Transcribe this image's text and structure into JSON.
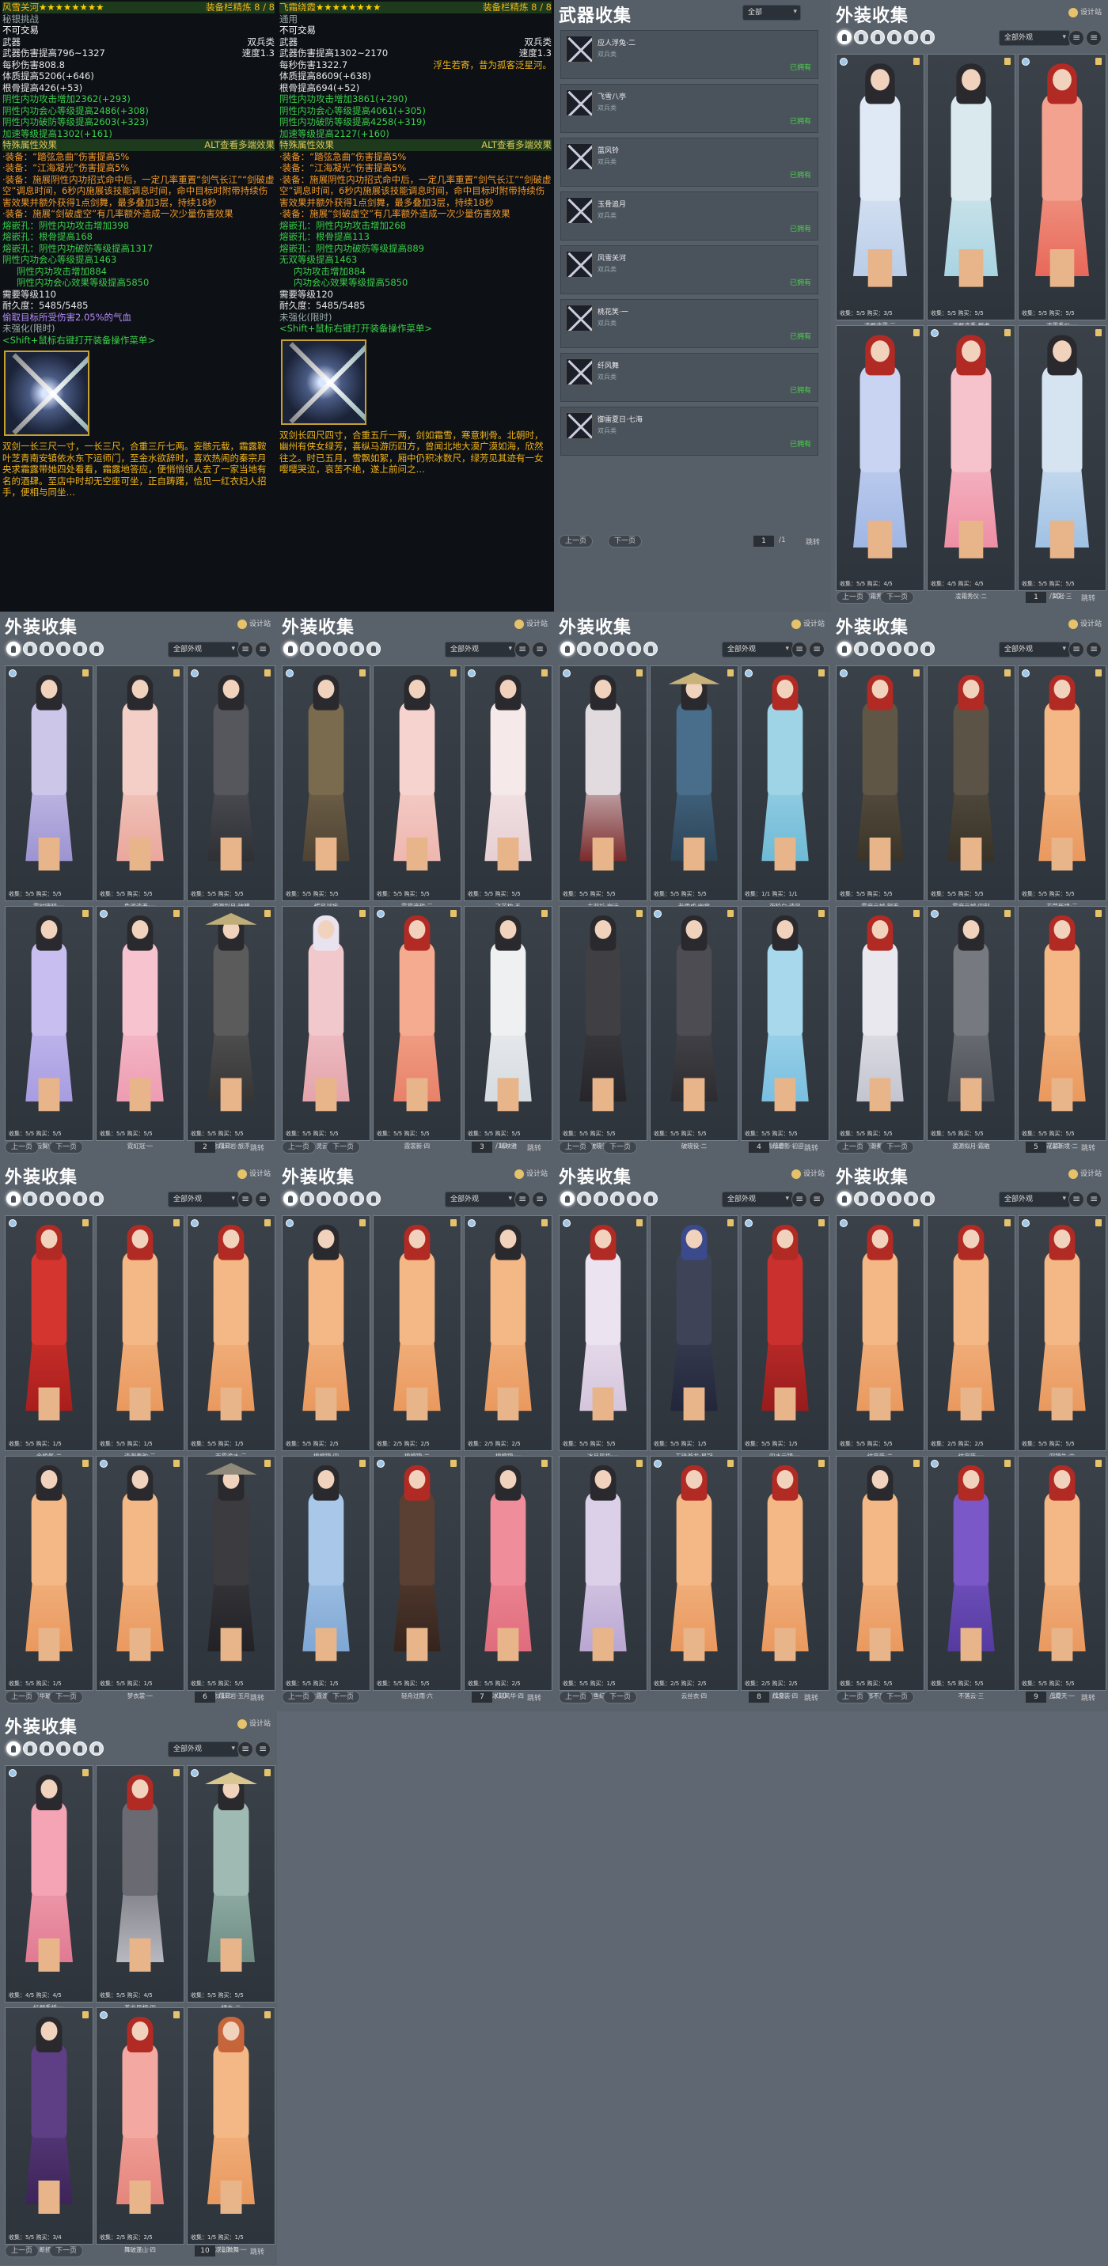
{
  "tooltips": [
    {
      "title": "风雪关河",
      "stars": "★★★★★★★★",
      "title_suffix": "…",
      "slot_right": "装备栏精炼 8 / 8",
      "sub1": "秘银挑战",
      "sub2": "不可交易",
      "type": "武器",
      "kind": "双兵类",
      "dmg": "武器伤害提高796~1327",
      "speed": "速度1.3",
      "dps": "每秒伤害808.8",
      "motto": "",
      "stats": [
        "体质提高5206(+646)",
        "根骨提高426(+53)",
        "阴性内功攻击增加2362(+293)",
        "阴性内功会心等级提高2486(+308)",
        "阴性内功破防等级提高2603(+323)",
        "加速等级提高1302(+161)"
      ],
      "special_hdr": "特殊属性效果",
      "special_right": "ALT查看多端效果",
      "specials": [
        "·装备：“踏弦急曲”伤害提高5%",
        "·装备：“江海凝光”伤害提高5%",
        "·装备：施展阴性内功招式命中后，一定几率重置“剑气长江”“剑破虚空”调息时间，6秒内施展该技能调息时间，命中目标时附带持续伤害效果并额外获得1点剑舞，最多叠加3层，持续18秒",
        "·装备：施展“剑破虚空”有几率额外造成一次少量伤害效果"
      ],
      "gems": [
        "熔嵌孔：阴性内功攻击增加398",
        "熔嵌孔：根骨提高168",
        "熔嵌孔：阴性内功破防等级提高1317"
      ],
      "set": [
        "阴性内功会心等级提高1463",
        "阴性内功攻击增加884",
        "阴性内功会心效果等级提高5850"
      ],
      "req": "需要等级110",
      "dur": "耐久度：5485/5485",
      "extra": "偷取目标所受伤害2.05%的气血",
      "unref": "未强化(限时)",
      "shift": "<Shift+鼠标右键打开装备操作菜单>",
      "lore": "双剑一长三尺一寸，一长三尺，合重三斤七两。妄骸元载，霜露鞍叶芝青南安镇依水东下运师门，至金水欲辞时，喜欢热闹的秦宗月央求霜露带她四处看看，霜露地答应，便悄悄领人去了一家当地有名的酒肆。至店中时却无空座可坐，正自踌躇，恰见一红衣妇人招手，便相与同坐…"
    },
    {
      "title": "飞霜绕霞",
      "stars": "★★★★★★★★",
      "title_suffix": "…",
      "slot_right": "装备栏精炼 8 / 8",
      "sub1": "通用",
      "sub2": "不可交易",
      "type": "武器",
      "kind": "双兵类",
      "dmg": "武器伤害提高1302~2170",
      "speed": "速度1.3",
      "dps": "每秒伤害1322.7",
      "motto": "浮生若寄，昔为孤客泛星河。",
      "stats": [
        "体质提高8609(+638)",
        "根骨提高694(+52)",
        "阴性内功攻击增加3861(+290)",
        "阴性内功会心等级提高4061(+305)",
        "阴性内功破防等级提高4258(+319)",
        "加速等级提高2127(+160)"
      ],
      "special_hdr": "特殊属性效果",
      "special_right": "ALT查看多端效果",
      "specials": [
        "·装备：“踏弦急曲”伤害提高5%",
        "·装备：“江海凝光”伤害提高5%",
        "·装备：施展阴性内功招式命中后，一定几率重置“剑气长江”“剑破虚空”调息时间，6秒内施展该技能调息时间，命中目标时附带持续伤害效果并额外获得1点剑舞，最多叠加3层，持续18秒",
        "·装备：施展“剑破虚空”有几率额外造成一次少量伤害效果"
      ],
      "gems": [
        "熔嵌孔：阴性内功攻击增加268",
        "熔嵌孔：根骨提高113",
        "熔嵌孔：阴性内功破防等级提高889"
      ],
      "set": [
        "无双等级提高1463",
        "内功攻击增加884",
        "内功会心效果等级提高5850"
      ],
      "req": "需要等级120",
      "dur": "耐久度：5485/5485",
      "extra": "",
      "unref": "未强化(限时)",
      "shift": "<Shift+鼠标右键打开装备操作菜单>",
      "lore": "双剑长四尺四寸，合重五斤一两，剑如霜雪，寒意刺骨。北朝时，幽州有侠女绿芳，喜纵马游历四方，曾闻北地大漠广漠如海，欣然往之。时已五月，雪飘如絮，厢中仍积冰数尺，绿芳见其迹有一女嘤嘤哭泣，哀苦不绝，遂上前问之…"
    }
  ],
  "weapons": {
    "title": "武器收集",
    "filter": "全部",
    "items": [
      {
        "name": "应人浮兔·二",
        "sub": "双兵类",
        "status": "已拥有"
      },
      {
        "name": "飞雪八亭",
        "sub": "双兵类",
        "status": "已拥有"
      },
      {
        "name": "蓝风铃",
        "sub": "双兵类",
        "status": "已拥有"
      },
      {
        "name": "玉骨追月",
        "sub": "双兵类",
        "status": "已拥有"
      },
      {
        "name": "风雪关河",
        "sub": "双兵类",
        "status": "已拥有"
      },
      {
        "name": "桃花笑·一",
        "sub": "双兵类",
        "status": "已拥有"
      },
      {
        "name": "纤风舞",
        "sub": "双兵类",
        "status": "已拥有"
      },
      {
        "name": "御雷夏日·七海",
        "sub": "双兵类",
        "status": "已拥有"
      }
    ],
    "prev": "上一页",
    "next": "下一页",
    "page": "1",
    "total": "/1",
    "jump": "跳转"
  },
  "outfits_common": {
    "title": "外装收集",
    "designer": "设计站",
    "filter": "全部外观",
    "prev": "上一页",
    "next": "下一页",
    "jump": "跳转",
    "total": "/10"
  },
  "outfit_pages": [
    {
      "page": "1",
      "cards": [
        {
          "name": "凌羁清露·三",
          "count": "收集：5/5  购买：3/5",
          "c1": "#dfe8f5",
          "c2": "#b9cde8",
          "hair": "#2a2a2e"
        },
        {
          "name": "凌羁凌秀·碧虚",
          "count": "收集：5/5  购买：5/5",
          "c1": "#d9e9ee",
          "c2": "#a8d4e2",
          "hair": "#2a2a2e"
        },
        {
          "name": "凌霜秀仪·一",
          "count": "收集：5/5  购买：5/5",
          "c1": "#f2a28e",
          "c2": "#e8685a",
          "hair": "#b22a24"
        },
        {
          "name": "凌霜秀仪·三",
          "count": "收集：5/5  购买：4/5",
          "c1": "#c9d4f2",
          "c2": "#9fb6e4",
          "hair": "#b22a24"
        },
        {
          "name": "凌霜秀仪·二",
          "count": "收集：4/5  购买：4/5",
          "c1": "#f6c2cc",
          "c2": "#ee8fa4",
          "hair": "#b22a24"
        },
        {
          "name": "凤冠·三",
          "count": "收集：5/5  购买：5/5",
          "c1": "#d6e4f2",
          "c2": "#9fc1e4",
          "hair": "#2a2a2e"
        }
      ]
    },
    {
      "page": "2",
      "cards": [
        {
          "name": "露时晓晴·一",
          "count": "收集：5/5  购买：5/5",
          "c1": "#ccc6e8",
          "c2": "#9c93d2",
          "hair": "#2a2a2e"
        },
        {
          "name": "鱼戏清西·一",
          "count": "收集：5/5  购买：5/5",
          "c1": "#f3cfc7",
          "c2": "#eaa79c",
          "hair": "#2a2a2e"
        },
        {
          "name": "渡源拟月·破碧",
          "count": "收集：5/5  购买：5/5",
          "c1": "#55575c",
          "c2": "#2f3035",
          "hair": "#2a2a2e"
        },
        {
          "name": "云鬓归·二",
          "count": "收集：5/5  购买：5/5",
          "c1": "#c8bff0",
          "c2": "#a79ce0",
          "hair": "#2a2a2e"
        },
        {
          "name": "霓虹冠·一",
          "count": "收集：5/5  购买：5/5",
          "c1": "#f6c3cf",
          "c2": "#ee9cb2",
          "hair": "#2a2a2e"
        },
        {
          "name": "念翊沉岩·旅浮",
          "count": "收集：5/5  购买：5/5",
          "c1": "#5b5b5b",
          "c2": "#353535",
          "hair": "#2a2a2e",
          "hat": "#bfae7a"
        }
      ]
    },
    {
      "page": "3",
      "cards": [
        {
          "name": "缓风战袍",
          "count": "收集：5/5  购买：5/5",
          "c1": "#7a6a4e",
          "c2": "#4e4334",
          "hair": "#2a2a2e"
        },
        {
          "name": "霞裳流甜·三",
          "count": "收集：5/5  购买：5/5",
          "c1": "#f6d3ce",
          "c2": "#eeb7af",
          "hair": "#2a2a2e"
        },
        {
          "name": "飞花枕·五",
          "count": "收集：5/5  购买：5/5",
          "c1": "#f6e9ea",
          "c2": "#e6cfd2",
          "hair": "#2a2a2e"
        },
        {
          "name": "灵云·四",
          "count": "收集：5/5  购买：5/5",
          "c1": "#f1c9cc",
          "c2": "#e4a3ab",
          "hair": "#e8e3ef"
        },
        {
          "name": "霞裳新·四",
          "count": "收集：5/5  购买：5/5",
          "c1": "#f4ab8f",
          "c2": "#e8816a",
          "hair": "#b22a24"
        },
        {
          "name": "晴映雅",
          "count": "收集：5/5  购买：5/5",
          "c1": "#eef0f2",
          "c2": "#d5dbe0",
          "hair": "#2a2a2e"
        }
      ]
    },
    {
      "page": "4",
      "cards": [
        {
          "name": "主羽衫·岗运",
          "count": "收集：5/5  购买：5/5",
          "c1": "#e1dbe0",
          "c2": "#7b2b2b",
          "hair": "#2a2a2e"
        },
        {
          "name": "赴雪成·幽堂",
          "count": "收集：5/5  购买：5/5",
          "c1": "#486e8c",
          "c2": "#2d4457",
          "hair": "#2a2a2e",
          "hat": "#c8b27a"
        },
        {
          "name": "夜阶白·清风",
          "count": "收集：1/1  购买：1/1",
          "c1": "#9fd4e6",
          "c2": "#6fbad6",
          "hair": "#b22a24"
        },
        {
          "name": "破晓役·一",
          "count": "收集：5/5  购买：5/5",
          "c1": "#3f3f44",
          "c2": "#26262a",
          "hair": "#2a2a2e"
        },
        {
          "name": "破晓役·二",
          "count": "收集：5/5  购买：5/5",
          "c1": "#4c4c52",
          "c2": "#2c2c30",
          "hair": "#2a2a2e"
        },
        {
          "name": "清绘碧影·初迎",
          "count": "收集：5/5  购买：5/5",
          "c1": "#a8d8ec",
          "c2": "#79bfe0",
          "hair": "#2a2a2e"
        }
      ]
    },
    {
      "page": "5",
      "cards": [
        {
          "name": "雾度云城·望天",
          "count": "收集：5/5  购买：5/5",
          "c1": "#5f5646",
          "c2": "#3a3428",
          "hair": "#b22a24"
        },
        {
          "name": "雾度云城·四刻",
          "count": "收集：5/5  购买：5/5",
          "c1": "#5a5346",
          "c2": "#373127",
          "hair": "#b22a24"
        },
        {
          "name": "花茵新境·三",
          "count": "收集：5/5  购买：5/5",
          "c1": "#f4b786",
          "c2": "#e9995e",
          "hair": "#b22a24"
        },
        {
          "name": "清潮奏韵·一",
          "count": "收集：5/5  购买：5/5",
          "c1": "#e8e8ee",
          "c2": "#c4c4d0",
          "hair": "#b22a24"
        },
        {
          "name": "渡源拟月·霜融",
          "count": "收集：5/5  购买：5/5",
          "c1": "#767a80",
          "c2": "#4d5157",
          "hair": "#2a2a2e"
        },
        {
          "name": "花茵新境·二",
          "count": "收集：5/5  购买：5/5",
          "c1": "#f4b786",
          "c2": "#e9995e",
          "hair": "#b22a24"
        }
      ]
    },
    {
      "page": "6",
      "cards": [
        {
          "name": "金梭气·二",
          "count": "收集：5/5  购买：1/5",
          "c1": "#d4352f",
          "c2": "#a81e1c",
          "hair": "#b22a24"
        },
        {
          "name": "清潮奏韵·三",
          "count": "收集：5/5  购买：1/5",
          "c1": "#f4b786",
          "c2": "#e9995e",
          "hair": "#b22a24"
        },
        {
          "name": "天霓渝水·三",
          "count": "收集：5/5  购买：1/5",
          "c1": "#f4b786",
          "c2": "#e9995e",
          "hair": "#b22a24"
        },
        {
          "name": "芳华璀璨·二",
          "count": "收集：5/5  购买：1/5",
          "c1": "#f4b786",
          "c2": "#e9995e",
          "hair": "#2a2a2e"
        },
        {
          "name": "梦衣裳·一",
          "count": "收集：5/5  购买：1/5",
          "c1": "#f4b786",
          "c2": "#e9995e",
          "hair": "#2a2a2e"
        },
        {
          "name": "念翊沉岩·五月",
          "count": "收集：5/5  购买：5/5",
          "c1": "#3b3b40",
          "c2": "#222226",
          "hair": "#2a2a2e",
          "hat": "#8f8a7a"
        }
      ]
    },
    {
      "page": "7",
      "cards": [
        {
          "name": "棉棉锦·四",
          "count": "收集：5/5  购买：2/5",
          "c1": "#f4b786",
          "c2": "#e9995e",
          "hair": "#2a2a2e"
        },
        {
          "name": "棉棉锦·二",
          "count": "收集：2/5  购买：2/5",
          "c1": "#f4b786",
          "c2": "#e9995e",
          "hair": "#b22a24"
        },
        {
          "name": "棉棉锦·一",
          "count": "收集：2/5  购买：2/5",
          "c1": "#f4b786",
          "c2": "#e9995e",
          "hair": "#2a2a2e"
        },
        {
          "name": "主霞渝水·三",
          "count": "收集：5/5  购买：1/5",
          "c1": "#a9c7e8",
          "c2": "#7ea7d4",
          "hair": "#2a2a2e"
        },
        {
          "name": "轻舟过雨·六",
          "count": "收集：5/5  购买：5/5",
          "c1": "#5a3f33",
          "c2": "#35241d",
          "hair": "#b22a24"
        },
        {
          "name": "冰月风华·四",
          "count": "收集：5/5  购买：2/5",
          "c1": "#f08d9a",
          "c2": "#e06c7c",
          "hair": "#2a2a2e"
        }
      ]
    },
    {
      "page": "8",
      "cards": [
        {
          "name": "冰月风华·一",
          "count": "收集：5/5  购买：5/5",
          "c1": "#ece3f0",
          "c2": "#d4c5dc",
          "hair": "#b22a24"
        },
        {
          "name": "玉锋游龙·星冠",
          "count": "收集：5/5  购买：1/5",
          "c1": "#3e4358",
          "c2": "#22263a",
          "hair": "#3a4a8a"
        },
        {
          "name": "四水云锦·一",
          "count": "收集：5/5  购买：1/5",
          "c1": "#c9302e",
          "c2": "#961c1c",
          "hair": "#b22a24"
        },
        {
          "name": "青鱼纪护·二",
          "count": "收集：5/5  购买：1/5",
          "c1": "#dcd0e8",
          "c2": "#b9a6d2",
          "hair": "#2a2a2e"
        },
        {
          "name": "云丝衣·四",
          "count": "收集：2/5  购买：2/5",
          "c1": "#f4b786",
          "c2": "#e9995e",
          "hair": "#b22a24"
        },
        {
          "name": "纹宫装·四",
          "count": "收集：2/5  购买：2/5",
          "c1": "#f4b786",
          "c2": "#e9995e",
          "hair": "#b22a24"
        }
      ]
    },
    {
      "page": "9",
      "cards": [
        {
          "name": "纹宫装·二",
          "count": "收集：5/5  购买：5/5",
          "c1": "#f4b786",
          "c2": "#e9995e",
          "hair": "#b22a24"
        },
        {
          "name": "纹宫装·一",
          "count": "收集：2/5  购买：2/5",
          "c1": "#f4b786",
          "c2": "#e9995e",
          "hair": "#b22a24"
        },
        {
          "name": "驭锦朱·六",
          "count": "收集：5/5  购买：5/5",
          "c1": "#f4b786",
          "c2": "#e9995e",
          "hair": "#b22a24"
        },
        {
          "name": "郎不真·三",
          "count": "收集：5/5  购买：5/5",
          "c1": "#f4b786",
          "c2": "#e9995e",
          "hair": "#2a2a2e"
        },
        {
          "name": "不落云·三",
          "count": "收集：5/5  购买：5/5",
          "c1": "#7a58c8",
          "c2": "#543a9e",
          "hair": "#b22a24"
        },
        {
          "name": "上霓天·一",
          "count": "收集：5/5  购买：5/5",
          "c1": "#f4b786",
          "c2": "#e9995e",
          "hair": "#b22a24"
        }
      ]
    },
    {
      "page": "10",
      "cards": [
        {
          "name": "红烟香桥·一",
          "count": "收集：4/5  购买：4/5",
          "c1": "#f4a4b4",
          "c2": "#e07a92",
          "hair": "#2a2a2e"
        },
        {
          "name": "苍玄凤翅·四",
          "count": "收集：5/5  购买：4/5",
          "c1": "#6a6a72",
          "c2": "#b8b8c0",
          "hair": "#b22a24"
        },
        {
          "name": "绿水·二",
          "count": "收集：5/5  购买：5/5",
          "c1": "#9fbab2",
          "c2": "#6d8c83",
          "hair": "#2a2a2e",
          "hat": "#d8c690"
        },
        {
          "name": "断扬·五",
          "count": "收集：5/5  购买：3/4",
          "c1": "#5e3e84",
          "c2": "#3c2458",
          "hair": "#2a2a2e"
        },
        {
          "name": "舞破蓬山·四",
          "count": "收集：2/5  购买：2/5",
          "c1": "#f3a9a2",
          "c2": "#e5857c",
          "hair": "#b22a24"
        },
        {
          "name": "凉山微舞·一",
          "count": "收集：1/5  购买：1/5",
          "c1": "#f4b786",
          "c2": "#e9995e",
          "hair": "#c7653a"
        }
      ]
    }
  ]
}
